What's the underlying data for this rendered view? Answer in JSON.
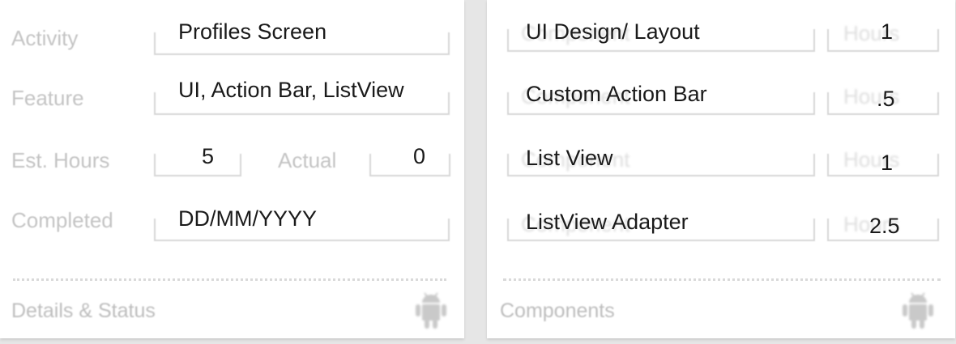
{
  "details": {
    "activity_label": "Activity",
    "activity_value": "Profiles Screen",
    "feature_label": "Feature",
    "feature_value": "UI, Action Bar, ListView",
    "est_hours_label": "Est. Hours",
    "est_hours_value": "5",
    "actual_label": "Actual",
    "actual_value": "0",
    "completed_label": "Completed",
    "completed_value": "DD/MM/YYYY",
    "footer_title": "Details & Status",
    "footer_icon": "android-icon"
  },
  "components": {
    "rows": [
      {
        "name": "UI Design/ Layout",
        "hours": "1",
        "name_ghost": "Component",
        "hours_ghost": "Hours"
      },
      {
        "name": "Custom Action Bar",
        "hours": ".5",
        "name_ghost": "Component",
        "hours_ghost": "Hours"
      },
      {
        "name": "List View",
        "hours": "1",
        "name_ghost": "Component",
        "hours_ghost": "Hours"
      },
      {
        "name": "ListView Adapter",
        "hours": "2.5",
        "name_ghost": "Component",
        "hours_ghost": "Hours"
      }
    ],
    "footer_title": "Components",
    "footer_icon": "android-icon"
  },
  "colors": {
    "background": "#e6e6e6",
    "card": "#ffffff",
    "label": "#c4c4c4",
    "value": "#1a1a1a"
  }
}
